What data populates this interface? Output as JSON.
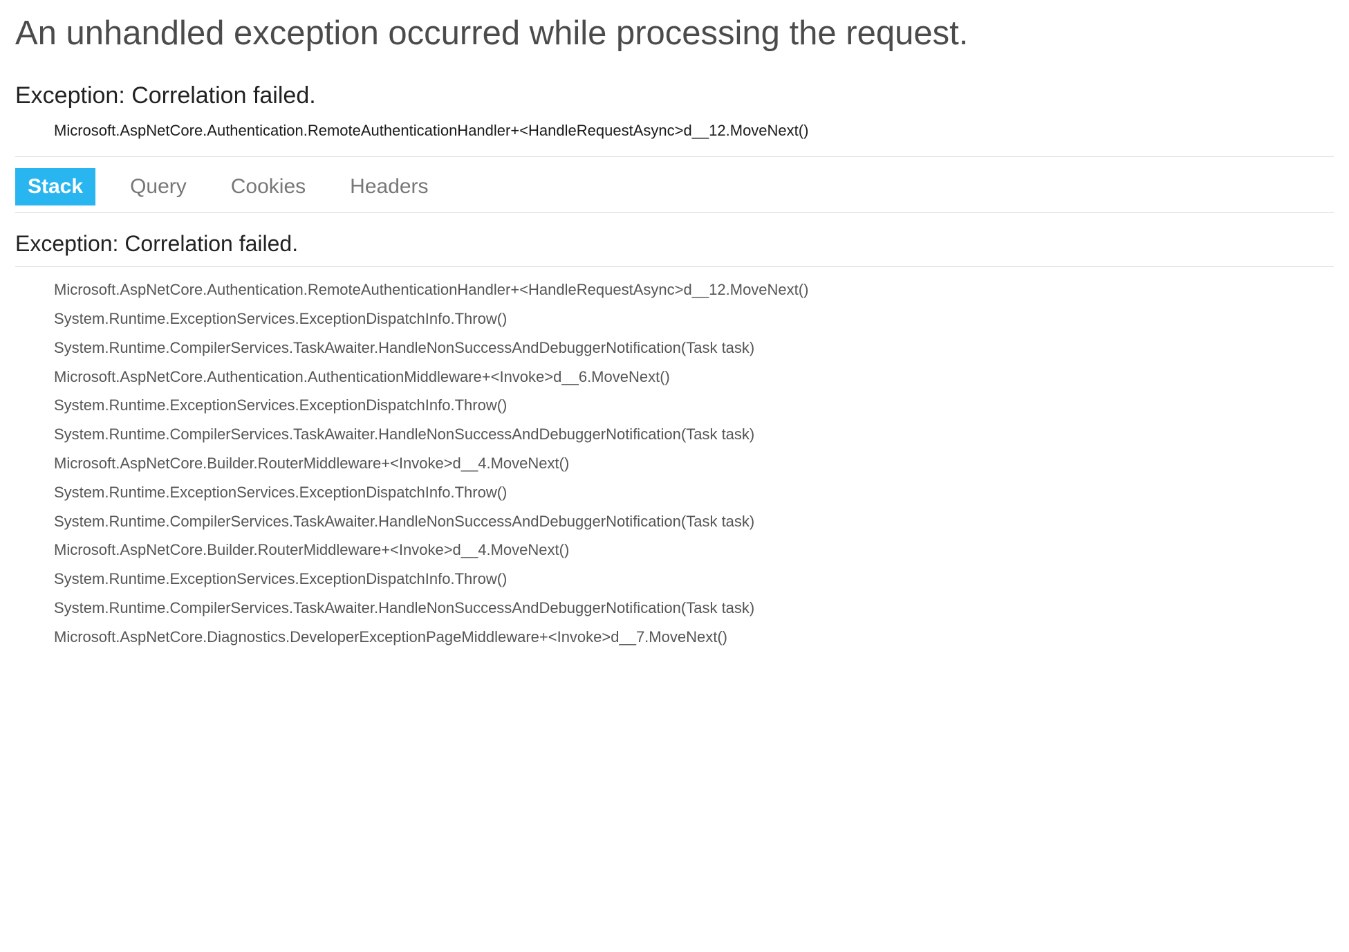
{
  "header": {
    "title": "An unhandled exception occurred while processing the request."
  },
  "exception": {
    "title": "Exception: Correlation failed.",
    "first_frame": "Microsoft.AspNetCore.Authentication.RemoteAuthenticationHandler+<HandleRequestAsync>d__12.MoveNext()"
  },
  "tabs": [
    {
      "label": "Stack",
      "active": true
    },
    {
      "label": "Query",
      "active": false
    },
    {
      "label": "Cookies",
      "active": false
    },
    {
      "label": "Headers",
      "active": false
    }
  ],
  "stack": {
    "title": "Exception: Correlation failed.",
    "frames": [
      "Microsoft.AspNetCore.Authentication.RemoteAuthenticationHandler+<HandleRequestAsync>d__12.MoveNext()",
      "System.Runtime.ExceptionServices.ExceptionDispatchInfo.Throw()",
      "System.Runtime.CompilerServices.TaskAwaiter.HandleNonSuccessAndDebuggerNotification(Task task)",
      "Microsoft.AspNetCore.Authentication.AuthenticationMiddleware+<Invoke>d__6.MoveNext()",
      "System.Runtime.ExceptionServices.ExceptionDispatchInfo.Throw()",
      "System.Runtime.CompilerServices.TaskAwaiter.HandleNonSuccessAndDebuggerNotification(Task task)",
      "Microsoft.AspNetCore.Builder.RouterMiddleware+<Invoke>d__4.MoveNext()",
      "System.Runtime.ExceptionServices.ExceptionDispatchInfo.Throw()",
      "System.Runtime.CompilerServices.TaskAwaiter.HandleNonSuccessAndDebuggerNotification(Task task)",
      "Microsoft.AspNetCore.Builder.RouterMiddleware+<Invoke>d__4.MoveNext()",
      "System.Runtime.ExceptionServices.ExceptionDispatchInfo.Throw()",
      "System.Runtime.CompilerServices.TaskAwaiter.HandleNonSuccessAndDebuggerNotification(Task task)",
      "Microsoft.AspNetCore.Diagnostics.DeveloperExceptionPageMiddleware+<Invoke>d__7.MoveNext()"
    ]
  }
}
